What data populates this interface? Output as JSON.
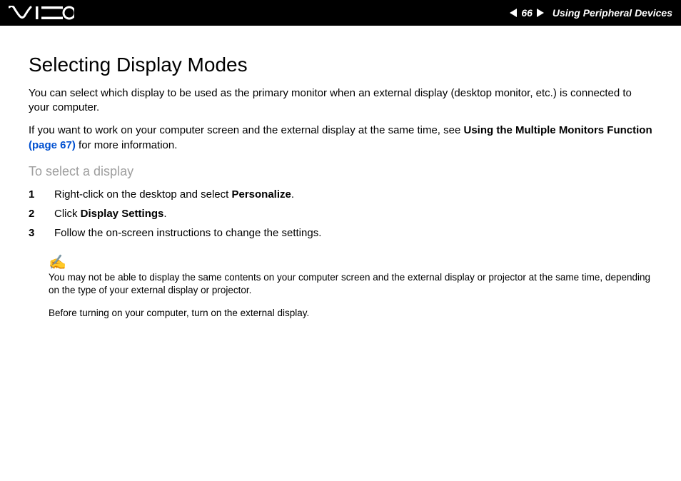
{
  "header": {
    "page_number": "66",
    "section": "Using Peripheral Devices"
  },
  "title": "Selecting Display Modes",
  "intro1": "You can select which display to be used as the primary monitor when an external display (desktop monitor, etc.) is connected to your computer.",
  "intro2_a": "If you want to work on your computer screen and the external display at the same time, see ",
  "intro2_bold": "Using the Multiple Monitors Function ",
  "intro2_link": "(page 67)",
  "intro2_b": " for more information.",
  "subhead": "To select a display",
  "steps": [
    {
      "n": "1",
      "text_a": "Right-click on the desktop and select ",
      "bold": "Personalize",
      "text_b": "."
    },
    {
      "n": "2",
      "text_a": "Click ",
      "bold": "Display Settings",
      "text_b": "."
    },
    {
      "n": "3",
      "text_a": "Follow the on-screen instructions to change the settings.",
      "bold": "",
      "text_b": ""
    }
  ],
  "note_icon": "✍",
  "note1": "You may not be able to display the same contents on your computer screen and the external display or projector at the same time, depending on the type of your external display or projector.",
  "note2": "Before turning on your computer, turn on the external display."
}
